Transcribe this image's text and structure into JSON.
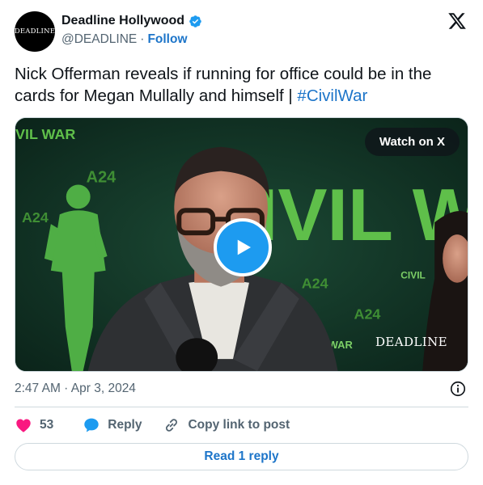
{
  "author": {
    "avatar_text": "DEADLINE",
    "display_name": "Deadline Hollywood",
    "handle": "@DEADLINE",
    "separator": "·",
    "follow_label": "Follow"
  },
  "tweet": {
    "text": "Nick Offerman reveals if running for office could be in the cards for Megan Mullally and himself  | ",
    "hashtag": "#CivilWar"
  },
  "media": {
    "watch_label": "Watch on X",
    "watermark": "DEADLINE",
    "backdrop_text": [
      "VIL WAR",
      "IVIL WA",
      "A24",
      "CIVIL",
      "WAR"
    ]
  },
  "meta": {
    "timestamp": "2:47 AM · Apr 3, 2024"
  },
  "actions": {
    "like_count": "53",
    "reply_label": "Reply",
    "copy_label": "Copy link to post"
  },
  "footer": {
    "read_reply_label": "Read 1 reply"
  },
  "colors": {
    "link": "#1d75c9",
    "verified": "#1d9bf0",
    "heart": "#f91880",
    "reply_bubble": "#1d9bf0",
    "text_secondary": "#536471",
    "border": "#cfd9de"
  }
}
